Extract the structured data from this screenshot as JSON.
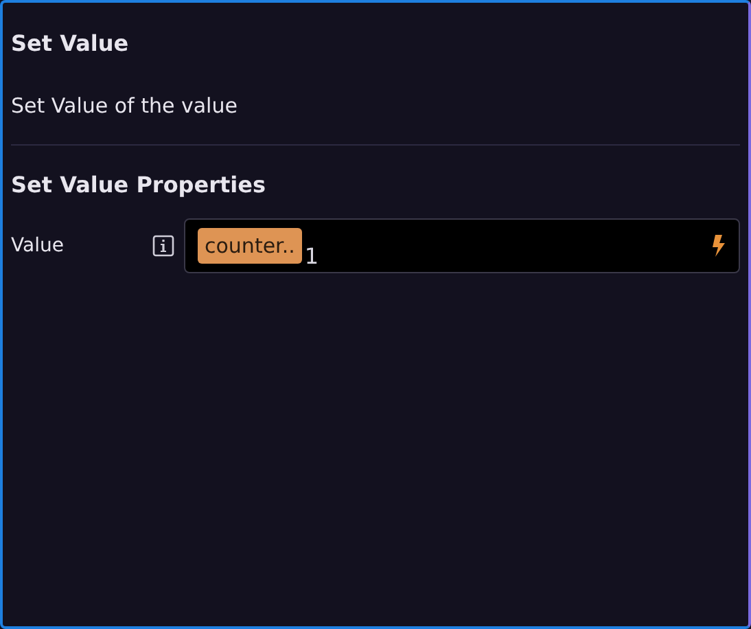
{
  "title": "Set Value",
  "description": "Set Value of the value",
  "section_title": "Set Value Properties",
  "properties": [
    {
      "label": "Value",
      "tokens": [
        {
          "kind": "variable",
          "text": "counter.."
        },
        {
          "kind": "text",
          "text": "1"
        }
      ]
    }
  ]
}
